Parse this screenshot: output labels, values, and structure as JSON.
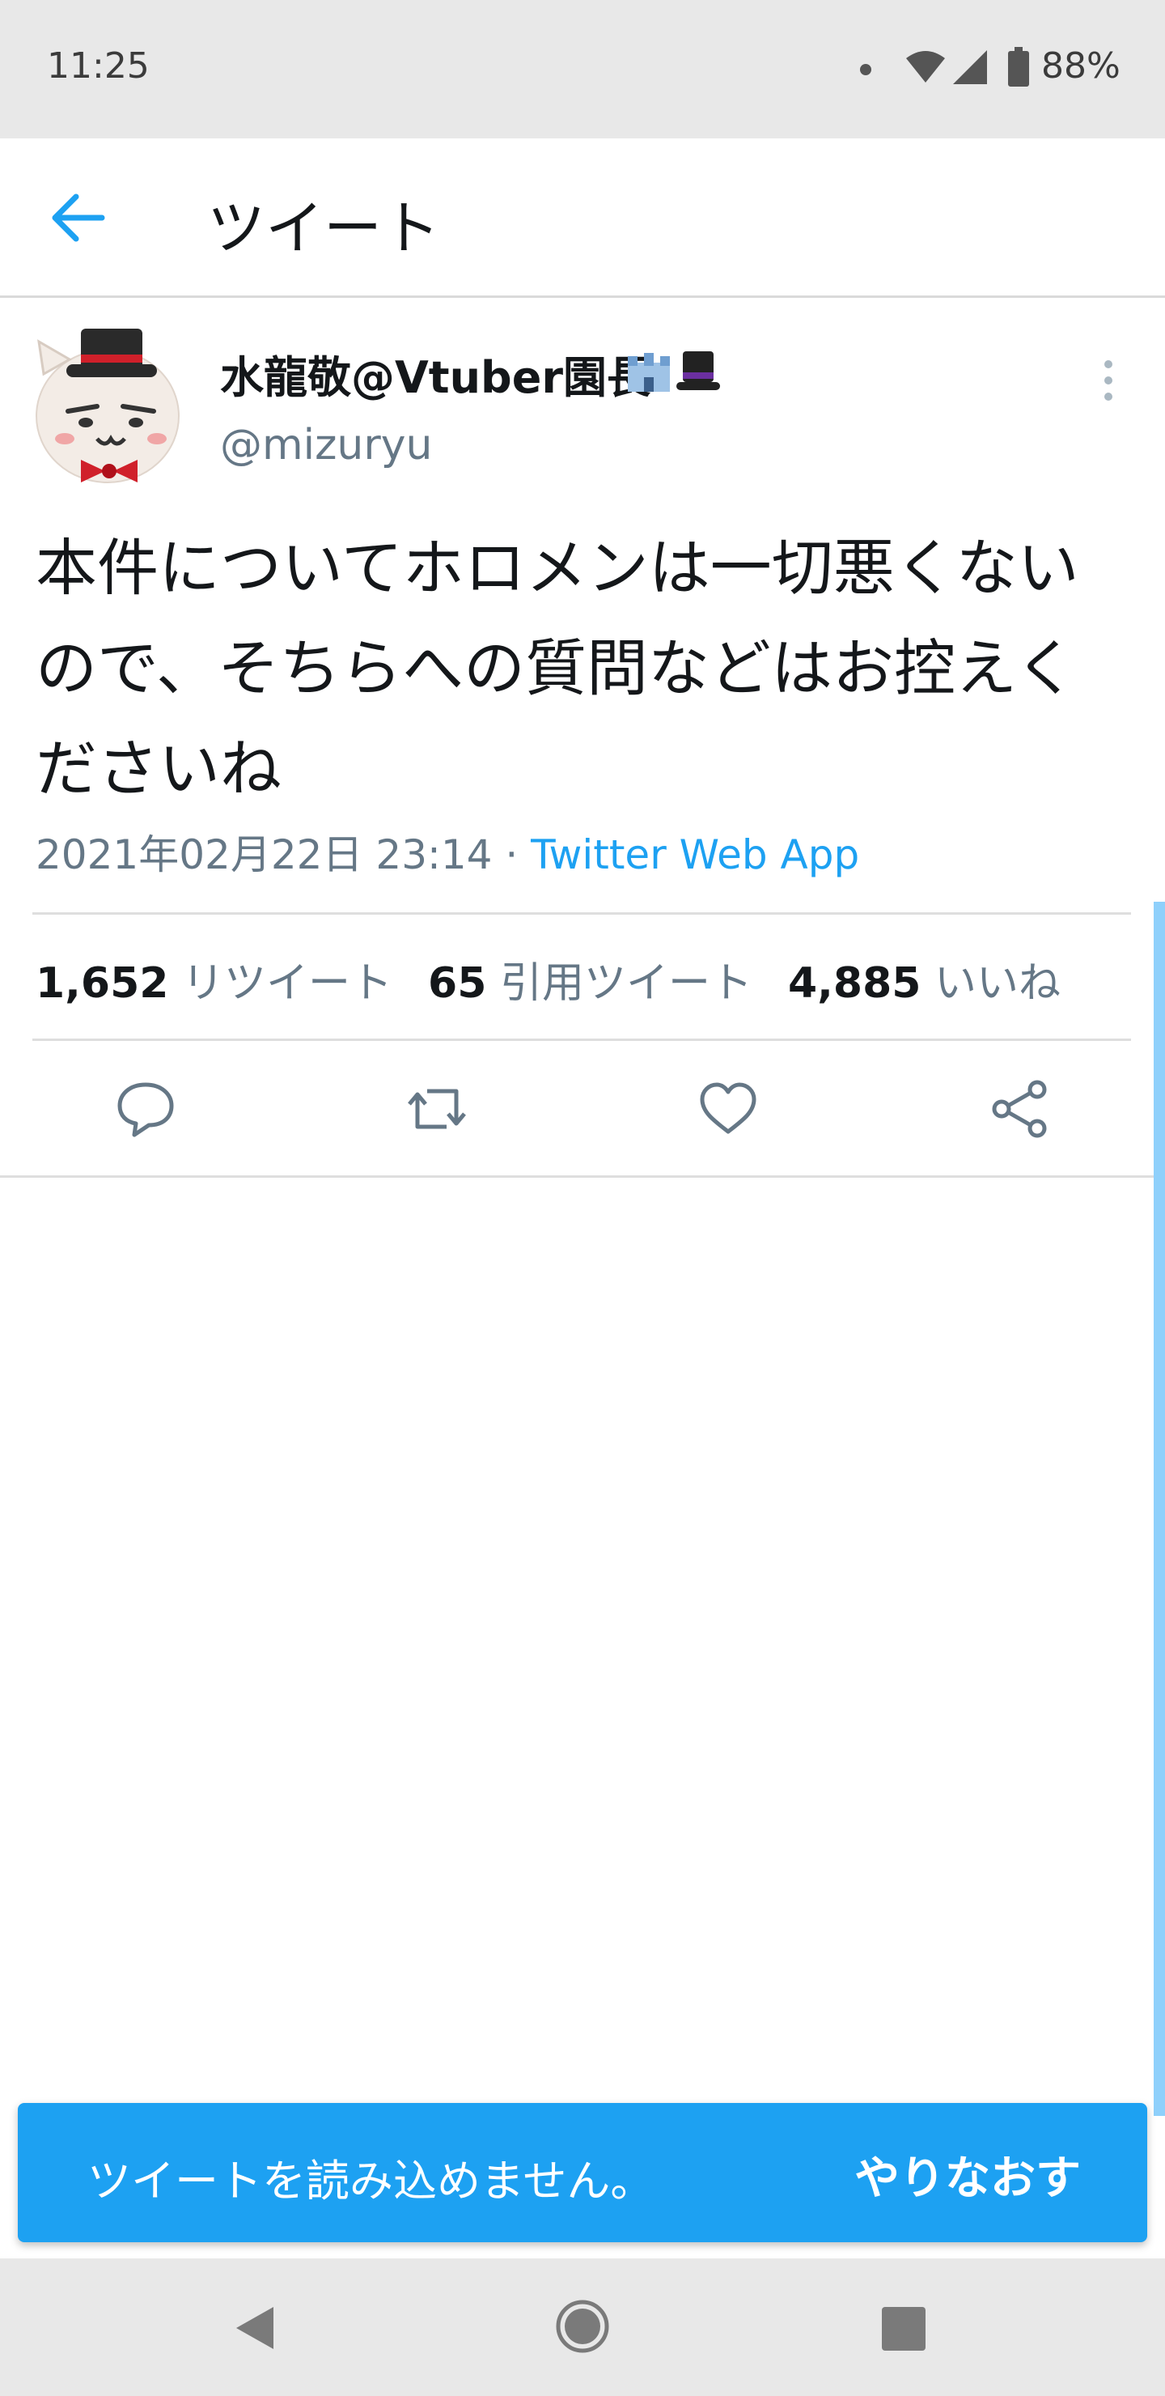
{
  "status_bar": {
    "time": "11:25",
    "battery": "88%",
    "icons": [
      "notification-dot-icon",
      "wifi-icon",
      "signal-icon",
      "battery-icon"
    ]
  },
  "header": {
    "title": "ツイート",
    "back_icon": "arrow-left-icon"
  },
  "tweet": {
    "author_name": "水龍敬@Vtuber園長",
    "author_emoji": [
      "castle-emoji",
      "top-hat-emoji"
    ],
    "handle": "@mizuryu",
    "text": "本件についてホロメンは一切悪くないので、そちらへの質問などはお控えくださいね",
    "date": "2021年02月22日 23:14",
    "separator": " · ",
    "source": "Twitter Web App",
    "stats": {
      "retweets": "1,652",
      "retweets_label": "リツイート",
      "quotes": "65",
      "quotes_label": "引用ツイート",
      "likes": "4,885",
      "likes_label": "いいね"
    },
    "actions": [
      "reply-icon",
      "retweet-icon",
      "like-icon",
      "share-icon"
    ]
  },
  "snackbar": {
    "message": "ツイートを読み込めません。",
    "action": "やりなおす"
  },
  "nav_bar": {
    "buttons": [
      "back-triangle-icon",
      "home-circle-icon",
      "recents-square-icon"
    ]
  },
  "colors": {
    "accent": "#1da1f2",
    "secondary_text": "#657786",
    "primary_text": "#14171a",
    "system_bar": "#e8e8e8"
  }
}
